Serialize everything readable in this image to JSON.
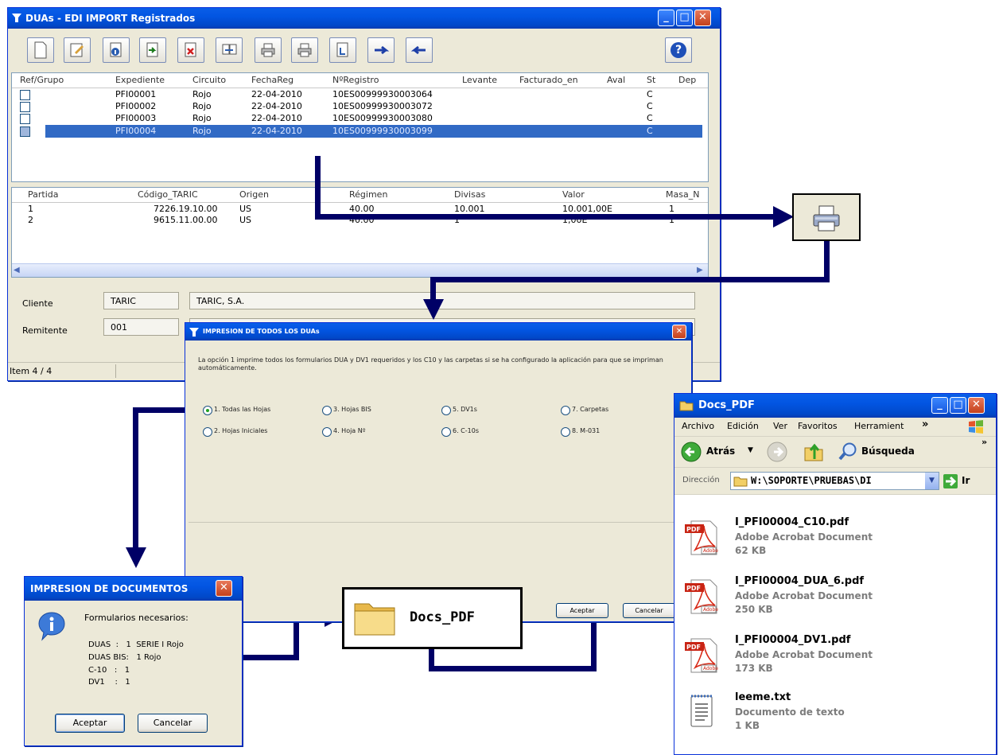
{
  "main_window": {
    "title": "DUAs  - EDI IMPORT Registrados",
    "min": "_",
    "max": "□",
    "close": "✕",
    "toolbar": [
      "new-document",
      "edit-document",
      "info",
      "import",
      "delete-red",
      "transfer",
      "print",
      "print-all",
      "next-arrow",
      "back",
      "forward",
      "help"
    ],
    "help_glyph": "?",
    "columns": [
      "Ref/Grupo",
      "Expediente",
      "Circuito",
      "FechaReg",
      "NºRegistro",
      "Levante",
      "Facturado_en",
      "Aval",
      "St",
      "Dep"
    ],
    "rows": [
      {
        "expediente": "PFI00001",
        "circuito": "Rojo",
        "fecha": "22-04-2010",
        "registro": "10ES00999930003064",
        "st": "C"
      },
      {
        "expediente": "PFI00002",
        "circuito": "Rojo",
        "fecha": "22-04-2010",
        "registro": "10ES00999930003072",
        "st": "C"
      },
      {
        "expediente": "PFI00003",
        "circuito": "Rojo",
        "fecha": "22-04-2010",
        "registro": "10ES00999930003080",
        "st": "C"
      },
      {
        "expediente": "PFI00004",
        "circuito": "Rojo",
        "fecha": "22-04-2010",
        "registro": "10ES00999930003099",
        "st": "C"
      }
    ],
    "lines_columns": [
      "Partida",
      "Código_TARIC",
      "Origen",
      "Régimen",
      "Divisas",
      "Valor",
      "Masa_N"
    ],
    "lines": [
      {
        "partida": "1",
        "taric": "7226.19.10.00",
        "origen": "US",
        "regimen": "40.00",
        "divisas": "10.001",
        "valor": "10.001,00E",
        "masa": "1"
      },
      {
        "partida": "2",
        "taric": "9615.11.00.00",
        "origen": "US",
        "regimen": "40.00",
        "divisas": "1",
        "valor": "1,00E",
        "masa": "1"
      }
    ],
    "cliente_label": "Cliente",
    "cliente_code": "TARIC",
    "cliente_name": "TARIC, S.A.",
    "remitente_label": "Remitente",
    "remitente_code": "001",
    "status": "Item 4 / 4"
  },
  "print_dialog": {
    "title": "IMPRESION DE TODOS LOS DUAs",
    "description": "La opción 1 imprime todos los formularios DUA y DV1 requeridos y los C10 y las carpetas si se ha configurado la aplicación para que se impriman automáticamente.",
    "options": [
      {
        "label": "1. Todas las Hojas",
        "checked": true
      },
      {
        "label": "3. Hojas BIS",
        "checked": false
      },
      {
        "label": "5. DV1s",
        "checked": false
      },
      {
        "label": "7. Carpetas",
        "checked": false
      },
      {
        "label": "2. Hojas Iniciales",
        "checked": false
      },
      {
        "label": "4. Hoja Nº",
        "checked": false
      },
      {
        "label": "6. C-10s",
        "checked": false
      },
      {
        "label": "8. M-031",
        "checked": false
      }
    ],
    "accept": "Aceptar",
    "cancel": "Cancelar"
  },
  "docs_dialog": {
    "title": "IMPRESION DE DOCUMENTOS",
    "heading": "Formularios necesarios:",
    "lines": [
      "DUAS  :   1  SERIE I Rojo",
      "DUAS BIS:   1 Rojo",
      "C-10   :   1",
      "DV1    :   1"
    ],
    "accept": "Aceptar",
    "cancel": "Cancelar"
  },
  "folder_box": {
    "label": "Docs_PDF"
  },
  "explorer": {
    "title": "Docs_PDF",
    "menu": [
      "Archivo",
      "Edición",
      "Ver",
      "Favoritos",
      "Herramient"
    ],
    "chevron": "»",
    "back": "Atrás",
    "search": "Búsqueda",
    "address_label": "Dirección",
    "address": "W:\\SOPORTE\\PRUEBAS\\DI",
    "go": "Ir",
    "files": [
      {
        "name": "I_PFI00004_C10.pdf",
        "type": "Adobe Acrobat Document",
        "size": "62 KB",
        "icon": "pdf"
      },
      {
        "name": "I_PFI00004_DUA_6.pdf",
        "type": "Adobe Acrobat Document",
        "size": "250 KB",
        "icon": "pdf"
      },
      {
        "name": "I_PFI00004_DV1.pdf",
        "type": "Adobe Acrobat Document",
        "size": "173 KB",
        "icon": "pdf"
      },
      {
        "name": "leeme.txt",
        "type": "Documento de texto",
        "size": "1 KB",
        "icon": "txt"
      }
    ],
    "pdf_badge": "PDF",
    "adobe_badge": "Adobe"
  },
  "colors": {
    "flow_arrow": "#000066",
    "selection": "#316ac5",
    "xp_title": "#0255e2"
  }
}
